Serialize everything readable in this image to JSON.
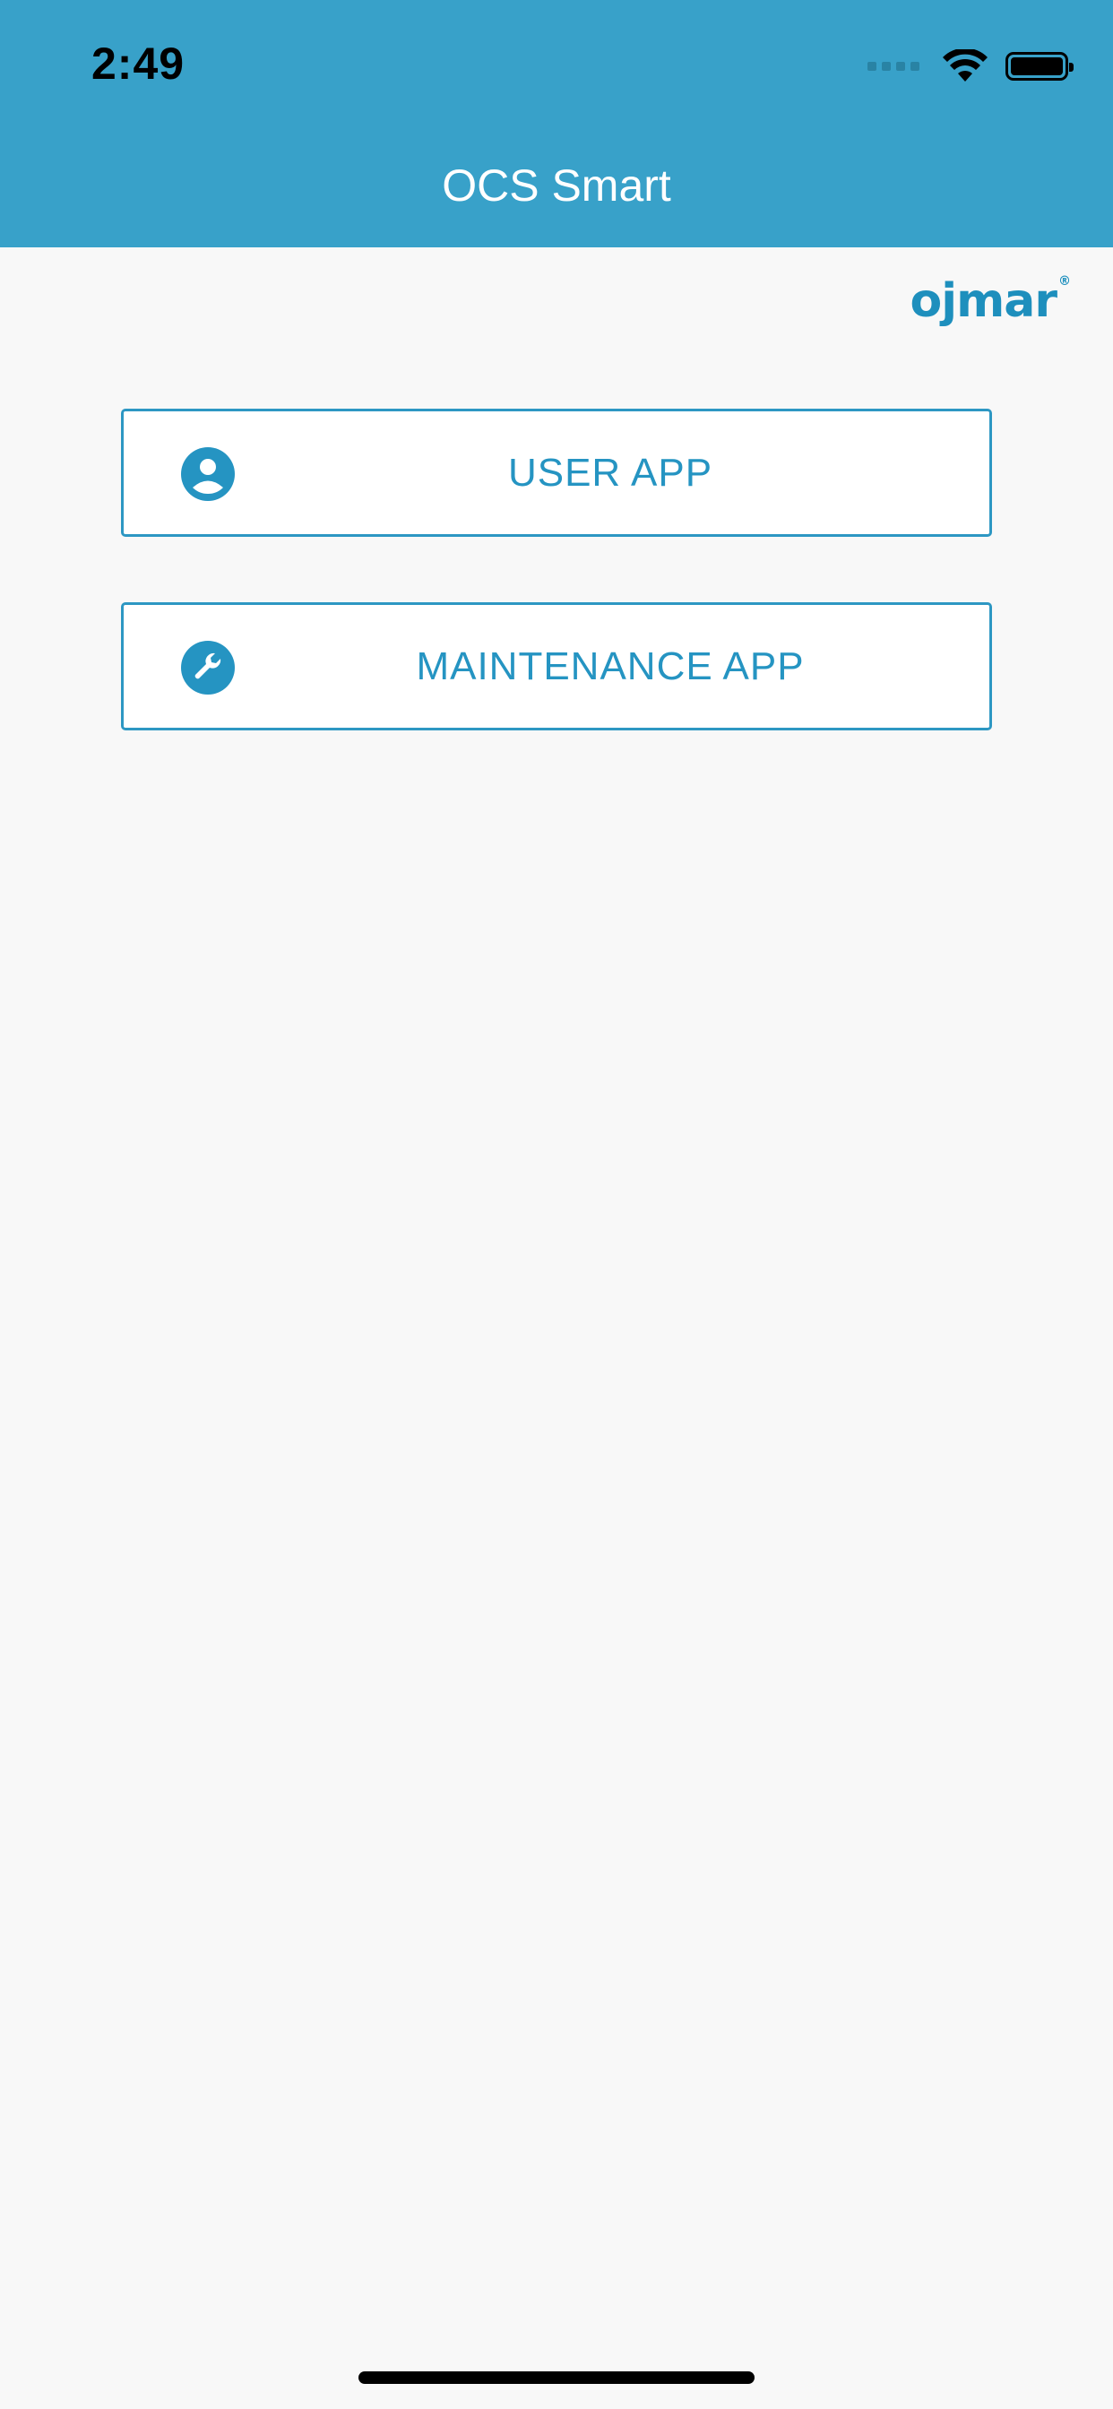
{
  "status_bar": {
    "time": "2:49"
  },
  "nav": {
    "title": "OCS Smart"
  },
  "brand": {
    "logo_text": "ojmar",
    "logo_mark": "®"
  },
  "buttons": [
    {
      "label": "USER APP",
      "icon": "user-icon"
    },
    {
      "label": "MAINTENANCE APP",
      "icon": "wrench-icon"
    }
  ],
  "colors": {
    "header": "#38a1c9",
    "accent": "#2594c2",
    "background": "#f8f8f8"
  }
}
